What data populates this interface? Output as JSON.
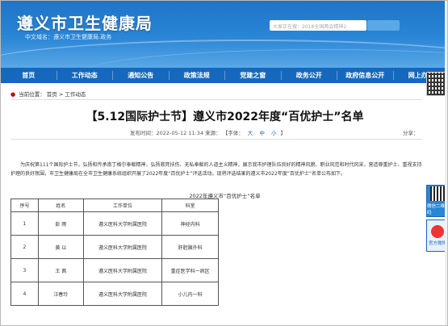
{
  "header": {
    "site_title": "遵义市卫生健康局",
    "domain_line": "中文域名：遵义市卫生健康局.政务",
    "search_placeholder": "大家正在搜：2018全国两会精神2"
  },
  "nav": {
    "items": [
      "首页",
      "工作动态",
      "通知公告",
      "政策法规",
      "党建之窗",
      "政务公开",
      "政府信息公开",
      "网上办事"
    ]
  },
  "breadcrumb": {
    "label": "当前位置：",
    "path": "首页 > 工作动态"
  },
  "article": {
    "title": "【5.12国际护士节】遵义市2022年度“百优护士”名单",
    "time_label": "发布时间：2022-05-12 11:34 来源：",
    "size_label": "【字体：",
    "size_large": "大",
    "size_medium": "中",
    "size_small": "小",
    "size_close": "】",
    "share_label": "分享：",
    "body": "为庆祝第111个国际护士节，弘扬和传承南丁格尔奉献精神，弘扬救死扶伤、无私奉献的人道主义精神，展示我市护理队伍良好的精神风貌、职业风范和时代风采，营造尊重护士、重视支持护理的良好氛围，市卫生健康局在全市卫生健康系统组织开展了2022年度“百优护士”评选活动。现将评选结果的遵义市2022年度“百优护士”名单公布如下。"
  },
  "table": {
    "caption": "2022年遵义市“百优护士”名单",
    "headers": [
      "序号",
      "姓名",
      "工作单位",
      "科室"
    ],
    "rows": [
      [
        "1",
        "彭 雨",
        "遵义医科大学附属医院",
        "神经内科"
      ],
      [
        "2",
        "黄 以",
        "遵义医科大学附属医院",
        "肝胆胰外科"
      ],
      [
        "3",
        "王 茜",
        "遵义医科大学附属医院",
        "重症医学科一病区"
      ],
      [
        "4",
        "汪春玲",
        "遵义医科大学附属医院",
        "小儿内一科"
      ]
    ]
  },
  "sidebar": {
    "wechat_label": "微信二维码",
    "weibo_label": "官方微博"
  },
  "colors": {
    "header_blue": "#2a86d6",
    "nav_blue": "#1668bd"
  }
}
